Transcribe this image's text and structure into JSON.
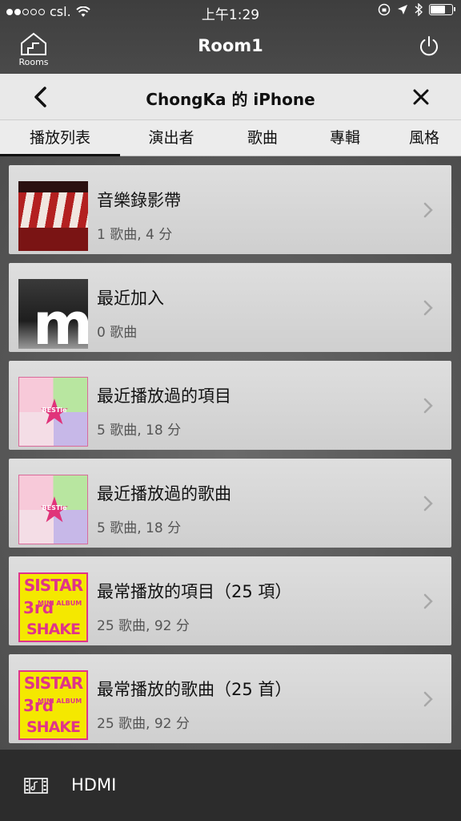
{
  "status_bar": {
    "carrier": "csl.",
    "time": "上午1:29",
    "battery_level": 0.65
  },
  "app_header": {
    "title": "Room1",
    "rooms_label": "Rooms"
  },
  "source": {
    "title": "ChongKa 的 iPhone"
  },
  "tabs": [
    {
      "label": "播放列表",
      "active": true
    },
    {
      "label": "演出者",
      "active": false
    },
    {
      "label": "歌曲",
      "active": false
    },
    {
      "label": "專輯",
      "active": false
    },
    {
      "label": "風格",
      "active": false
    }
  ],
  "playlists": [
    {
      "title": "音樂錄影帶",
      "subtitle": "1 歌曲, 4 分"
    },
    {
      "title": "最近加入",
      "subtitle": "0 歌曲"
    },
    {
      "title": "最近播放過的項目",
      "subtitle": "5 歌曲, 18 分"
    },
    {
      "title": "最近播放過的歌曲",
      "subtitle": "5 歌曲, 18 分"
    },
    {
      "title": "最常播放的項目（25 項）",
      "subtitle": "25 歌曲, 92 分"
    },
    {
      "title": "最常播放的歌曲（25 首）",
      "subtitle": "25 歌曲, 92 分"
    }
  ],
  "thumb_text": {
    "recent_letter": "m",
    "bestie": "BESTie",
    "sistar_1": "SISTAR",
    "sistar_2": "3rd",
    "sistar_3": "MINI ALBUM",
    "sistar_4": "SHAKE IT"
  },
  "now_playing": {
    "label": "HDMI"
  },
  "icons": {
    "rooms": "house-icon",
    "power": "power-icon",
    "back": "chevron-left-icon",
    "close": "close-icon",
    "row_arrow": "chevron-right-icon",
    "hdmi": "film-icon"
  }
}
